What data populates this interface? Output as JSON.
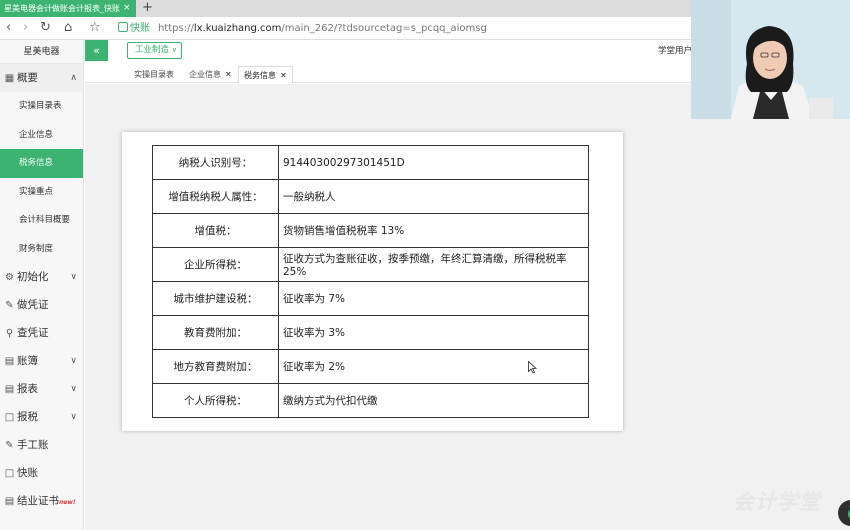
{
  "browser": {
    "tab_title": "星美电器会计做账会计报表_快账",
    "tab_close": "×",
    "new_tab": "+",
    "quick_label": "快账",
    "url_scheme": "https://",
    "url_host": "lx.kuaizhang.com",
    "url_path": "/main_262/?tdsourcetag=s_pcqq_aiomsg"
  },
  "sidebar": {
    "brand": "星美电器",
    "groups": [
      {
        "label": "概要",
        "icon": "grid-icon"
      },
      {
        "label": "初始化",
        "icon": "gear-icon"
      },
      {
        "label": "做凭证",
        "icon": "pencil-icon"
      },
      {
        "label": "查凭证",
        "icon": "search-icon"
      },
      {
        "label": "账簿",
        "icon": "book-icon"
      },
      {
        "label": "报表",
        "icon": "report-icon"
      },
      {
        "label": "报税",
        "icon": "document-icon"
      },
      {
        "label": "手工账",
        "icon": "pencil-icon"
      },
      {
        "label": "快账",
        "icon": "document-icon"
      },
      {
        "label": "结业证书",
        "icon": "certificate-icon",
        "badge": "new!"
      }
    ],
    "sub_items": [
      "实操目录表",
      "企业信息",
      "税务信息",
      "实操重点",
      "会计科目概要",
      "财务制度"
    ],
    "active_sub": "税务信息"
  },
  "header": {
    "collapse_icon": "«",
    "industry_select": "工业制造",
    "user_label": "学堂用户_"
  },
  "page_tabs": [
    {
      "label": "实操目录表",
      "closable": false
    },
    {
      "label": "企业信息",
      "closable": true
    },
    {
      "label": "税务信息",
      "closable": true,
      "active": true
    }
  ],
  "tax_info": [
    {
      "label": "纳税人识别号：",
      "value": "91440300297301451D"
    },
    {
      "label": "增值税纳税人属性：",
      "value": "一般纳税人"
    },
    {
      "label": "增值税：",
      "value": "货物销售增值税税率 13%"
    },
    {
      "label": "企业所得税：",
      "value": "征收方式为查账征收，按季预缴，年终汇算清缴，所得税税率 25%"
    },
    {
      "label": "城市维护建设税：",
      "value": "征收率为 7%"
    },
    {
      "label": "教育费附加：",
      "value": "征收率为 3%"
    },
    {
      "label": "地方教育费附加：",
      "value": "征收率为 2%"
    },
    {
      "label": "个人所得税：",
      "value": "缴纳方式为代扣代缴"
    }
  ],
  "watermark": "会计学堂",
  "colors": {
    "accent": "#3cb371",
    "sidebar_bg": "#f7f7f7",
    "content_bg": "#f1f1f1"
  }
}
